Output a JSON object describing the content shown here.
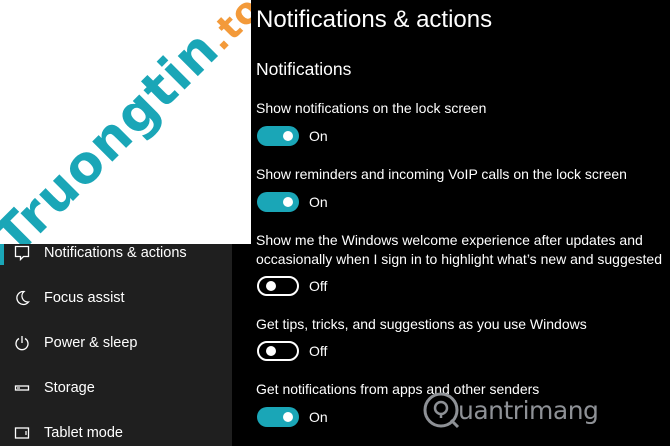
{
  "watermark_top_left": {
    "main": "Truongtin",
    "tld": ".top"
  },
  "watermark_bottom_right": {
    "text": "uantrimang"
  },
  "sidebar": {
    "items": [
      {
        "label": "Notifications & actions",
        "icon": "notification-icon",
        "active": true
      },
      {
        "label": "Focus assist",
        "icon": "moon-icon",
        "active": false
      },
      {
        "label": "Power & sleep",
        "icon": "power-icon",
        "active": false
      },
      {
        "label": "Storage",
        "icon": "storage-icon",
        "active": false
      },
      {
        "label": "Tablet mode",
        "icon": "tablet-icon",
        "active": false
      }
    ]
  },
  "main": {
    "title": "Notifications & actions",
    "section": "Notifications",
    "settings": [
      {
        "label": "Show notifications on the lock screen",
        "state": "On",
        "on": true
      },
      {
        "label": "Show reminders and incoming VoIP calls on the lock screen",
        "state": "On",
        "on": true
      },
      {
        "label_line1": "Show me the Windows welcome experience after updates and",
        "label_line2": "occasionally when I sign in to highlight what’s new and suggested",
        "state": "Off",
        "on": false
      },
      {
        "label": "Get tips, tricks, and suggestions as you use Windows",
        "state": "Off",
        "on": false
      },
      {
        "label": "Get notifications from apps and other senders",
        "state": "On",
        "on": true
      }
    ]
  },
  "colors": {
    "accent": "#1aa6b7",
    "sidebar_bg": "#1f1f1f",
    "content_bg": "#000000",
    "watermark_orange": "#f39a3a"
  }
}
